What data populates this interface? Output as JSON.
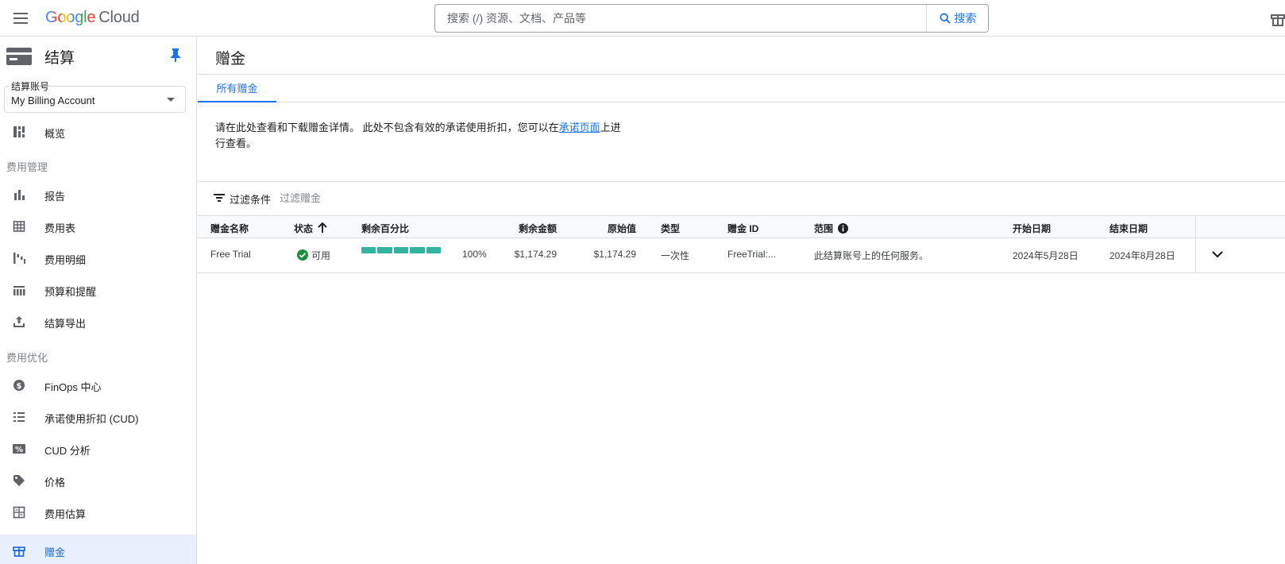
{
  "topbar": {
    "menu_icon": "hamburger-icon",
    "logo_google": "Google",
    "logo_cloud": "Cloud",
    "search_placeholder": "搜索 (/) 资源、文档、产品等",
    "search_button": "搜索"
  },
  "sidebar": {
    "title": "结算",
    "account_label": "结算账号",
    "account_value": "My Billing Account",
    "items": [
      {
        "label": "概览",
        "icon": "dashboard-icon"
      },
      {
        "label": "报告",
        "icon": "bar-chart-icon"
      },
      {
        "label": "费用表",
        "icon": "table-icon"
      },
      {
        "label": "费用明细",
        "icon": "waterfall-icon"
      },
      {
        "label": "预算和提醒",
        "icon": "budget-icon"
      },
      {
        "label": "结算导出",
        "icon": "upload-icon"
      },
      {
        "label": "FinOps 中心",
        "icon": "dollar-icon"
      },
      {
        "label": "承诺使用折扣 (CUD)",
        "icon": "list-icon"
      },
      {
        "label": "CUD 分析",
        "icon": "percent-icon"
      },
      {
        "label": "价格",
        "icon": "tag-icon"
      },
      {
        "label": "费用估算",
        "icon": "calculator-icon"
      },
      {
        "label": "赠金",
        "icon": "gift-icon"
      }
    ],
    "sections": [
      "费用管理",
      "费用优化"
    ]
  },
  "main": {
    "title": "赠金",
    "tabs": [
      {
        "label": "所有赠金"
      }
    ],
    "description_1": "请在此处查看和下载赠金详情。 此处不包含有效的承诺使用折扣，您可以在",
    "description_link": "承诺页面",
    "description_2": "上进行查看。",
    "filter_label": "过滤条件",
    "filter_placeholder": "过滤赠金"
  },
  "table": {
    "headers": [
      "赠金名称",
      "状态",
      "剩余百分比",
      "剩余金额",
      "原始值",
      "类型",
      "赠金 ID",
      "范围",
      "开始日期",
      "结束日期"
    ],
    "rows": [
      {
        "name": "Free Trial",
        "status": "可用",
        "percent_remaining": 100,
        "percent_text": "100%",
        "remaining": "$1,174.29",
        "original": "$1,174.29",
        "type": "一次性",
        "id": "FreeTrial:...",
        "scope": "此结算账号上的任何服务。",
        "start": "2024年5月28日",
        "end": "2024年8月28日"
      }
    ]
  },
  "colors": {
    "accent": "#1a73e8",
    "progress": "#34b3a0",
    "status_ok": "#1e8e3e"
  }
}
